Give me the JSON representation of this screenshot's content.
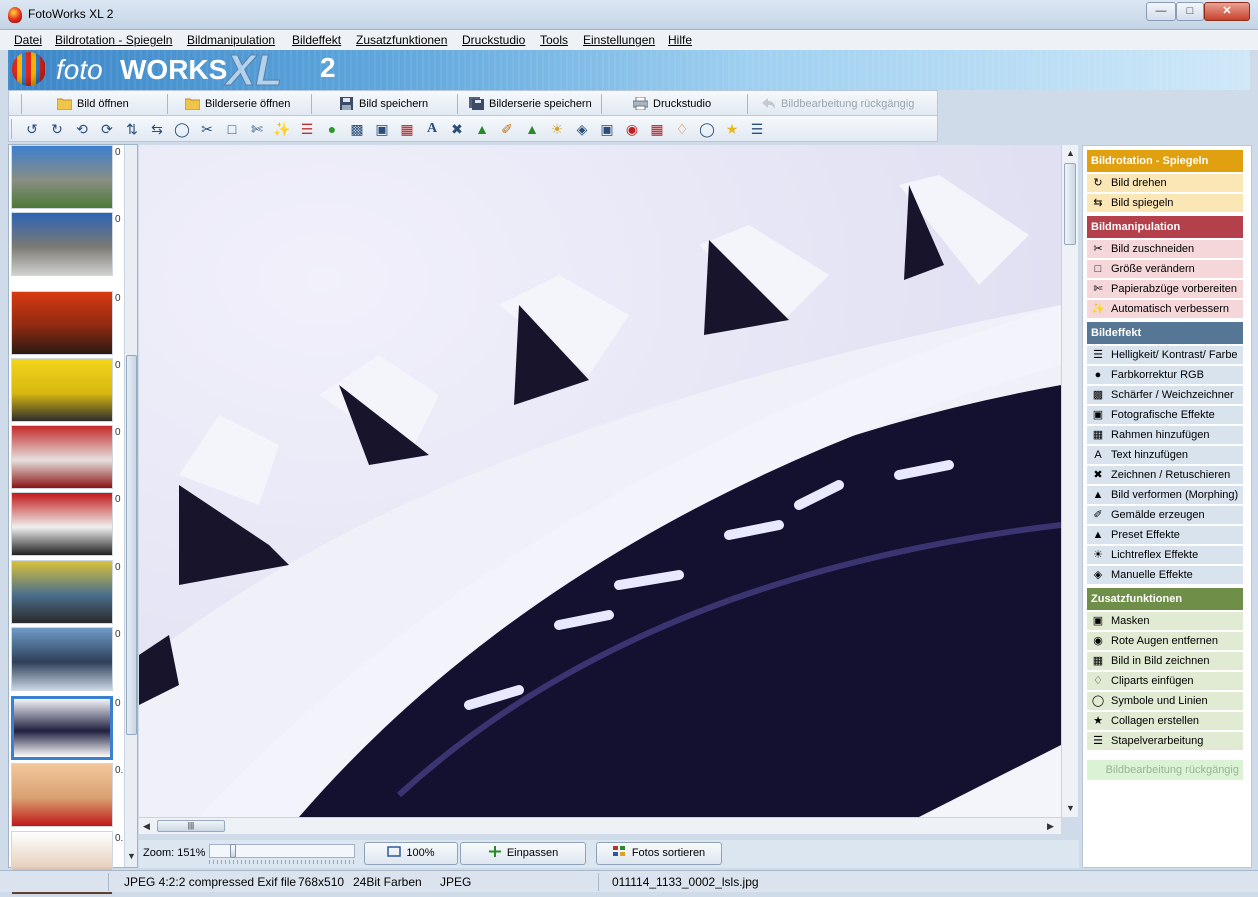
{
  "window": {
    "title": "FotoWorks XL 2",
    "controls": [
      "minimize",
      "maximize",
      "close"
    ]
  },
  "menu": [
    {
      "label": "Datei",
      "name": "menu-datei"
    },
    {
      "label": "Bildrotation - Spiegeln",
      "name": "menu-bildrotation"
    },
    {
      "label": "Bildmanipulation",
      "name": "menu-bildmanipulation"
    },
    {
      "label": "Bildeffekt",
      "name": "menu-bildeffekt"
    },
    {
      "label": "Zusatzfunktionen",
      "name": "menu-zusatzfunktionen"
    },
    {
      "label": "Druckstudio",
      "name": "menu-druckstudio"
    },
    {
      "label": "Tools",
      "name": "menu-tools"
    },
    {
      "label": "Einstellungen",
      "name": "menu-einstellungen"
    },
    {
      "label": "Hilfe",
      "name": "menu-hilfe"
    }
  ],
  "banner": {
    "foto": "foto",
    "works": "WORKS",
    "xl": "XL",
    "version": "2"
  },
  "toolbar": {
    "open_image": "Bild öffnen",
    "open_series": "Bilderserie öffnen",
    "save_image": "Bild speichern",
    "save_series": "Bilderserie speichern",
    "print_studio": "Druckstudio",
    "undo": "Bildbearbeitung rückgängig"
  },
  "tools": [
    "rotate-left-icon",
    "rotate-right-icon",
    "rotate-ccw-icon",
    "rotate-cw-icon",
    "flip-icon",
    "mirror-icon",
    "perspective-icon",
    "cut-icon",
    "crop-icon",
    "print-prep-icon",
    "auto-enhance-icon",
    "brightness-icon",
    "color-rgb-icon",
    "sharpen-icon",
    "photo-effect-icon",
    "frame-icon",
    "text-icon",
    "draw-icon",
    "morph-icon",
    "painting-icon",
    "preset-icon",
    "lens-flare-icon",
    "manual-effect-icon",
    "mask-icon",
    "red-eye-icon",
    "picture-in-picture-icon",
    "clipart-icon",
    "symbols-icon",
    "collage-icon",
    "batch-icon"
  ],
  "thumbnails": [
    {
      "num": "0",
      "colors": [
        "#3c7fd0",
        "#8a8e84",
        "#4c7a36"
      ]
    },
    {
      "num": "0",
      "colors": [
        "#2d64b5",
        "#7c7a74",
        "#d0d2d0"
      ]
    },
    {
      "num": "0",
      "colors": [
        "#d83a10",
        "#8e2a12",
        "#2a1a12"
      ]
    },
    {
      "num": "0",
      "colors": [
        "#f2d51c",
        "#d8b810",
        "#2e2e2e"
      ]
    },
    {
      "num": "0",
      "colors": [
        "#c32a2a",
        "#e6e0de",
        "#8a1414"
      ]
    },
    {
      "num": "0",
      "colors": [
        "#c21818",
        "#f0f0f0",
        "#202020"
      ]
    },
    {
      "num": "0",
      "colors": [
        "#d9c23a",
        "#4a6e8c",
        "#2a2a2a"
      ]
    },
    {
      "num": "0",
      "colors": [
        "#6e9cc8",
        "#2f3f58",
        "#c8d6e4"
      ]
    },
    {
      "num": "0",
      "colors": [
        "#f4f4fa",
        "#202040",
        "#ffffff"
      ]
    },
    {
      "num": "0.",
      "colors": [
        "#f2c79c",
        "#d8a070",
        "#c01818"
      ]
    },
    {
      "num": "0.",
      "colors": [
        "#ffffff",
        "#e8d2c0",
        "#5a3a2a"
      ]
    }
  ],
  "zoom": {
    "label": "Zoom: 151%",
    "level": 151,
    "btn_100": "100%",
    "btn_fit": "Einpassen",
    "btn_sort": "Fotos sortieren"
  },
  "sidebar": {
    "sections": [
      {
        "title": "Bildrotation - Spiegeln",
        "color": "#e1a010",
        "item_bg": "#fbe6b6",
        "items": [
          {
            "label": "Bild drehen",
            "icon": "rotate-image-icon"
          },
          {
            "label": "Bild spiegeln",
            "icon": "mirror-image-icon"
          }
        ]
      },
      {
        "title": "Bildmanipulation",
        "color": "#b3404a",
        "item_bg": "#f5d7d9",
        "items": [
          {
            "label": "Bild zuschneiden",
            "icon": "scissors-icon"
          },
          {
            "label": "Größe verändern",
            "icon": "resize-icon"
          },
          {
            "label": "Papierabzüge vorbereiten",
            "icon": "paper-prints-icon"
          },
          {
            "label": "Automatisch verbessern",
            "icon": "magic-wand-icon"
          }
        ]
      },
      {
        "title": "Bildeffekt",
        "color": "#567695",
        "item_bg": "#d8e3ee",
        "items": [
          {
            "label": "Helligkeit/ Kontrast/ Farbe",
            "icon": "sliders-icon"
          },
          {
            "label": "Farbkorrektur RGB",
            "icon": "rgb-icon"
          },
          {
            "label": "Schärfer / Weichzeichner",
            "icon": "sharpen-icon"
          },
          {
            "label": "Fotografische Effekte",
            "icon": "camera-icon"
          },
          {
            "label": "Rahmen hinzufügen",
            "icon": "frame-icon"
          },
          {
            "label": "Text hinzufügen",
            "icon": "text-icon"
          },
          {
            "label": "Zeichnen / Retuschieren",
            "icon": "brush-icon"
          },
          {
            "label": "Bild verformen (Morphing)",
            "icon": "morph-icon"
          },
          {
            "label": "Gemälde erzeugen",
            "icon": "painting-icon"
          },
          {
            "label": "Preset Effekte",
            "icon": "preset-icon"
          },
          {
            "label": "Lichtreflex Effekte",
            "icon": "lens-flare-icon"
          },
          {
            "label": "Manuelle Effekte",
            "icon": "manual-effect-icon"
          }
        ]
      },
      {
        "title": "Zusatzfunktionen",
        "color": "#6f8e48",
        "item_bg": "#e1ead2",
        "items": [
          {
            "label": "Masken",
            "icon": "mask-icon"
          },
          {
            "label": "Rote Augen entfernen",
            "icon": "red-eye-icon"
          },
          {
            "label": "Bild in Bild zeichnen",
            "icon": "picture-in-picture-icon"
          },
          {
            "label": "Cliparts einfügen",
            "icon": "clipart-icon"
          },
          {
            "label": "Symbole und Linien",
            "icon": "symbols-icon"
          },
          {
            "label": "Collagen erstellen",
            "icon": "star-icon"
          },
          {
            "label": "Stapelverarbeitung",
            "icon": "batch-icon"
          }
        ]
      }
    ],
    "undo": "Bildbearbeitung rückgängig"
  },
  "status": {
    "format": "JPEG 4:2:2 compressed Exif file",
    "dimensions": "768x510",
    "depth": "24Bit Farben",
    "type": "JPEG",
    "filename": "011114_1133_0002_lsls.jpg"
  }
}
